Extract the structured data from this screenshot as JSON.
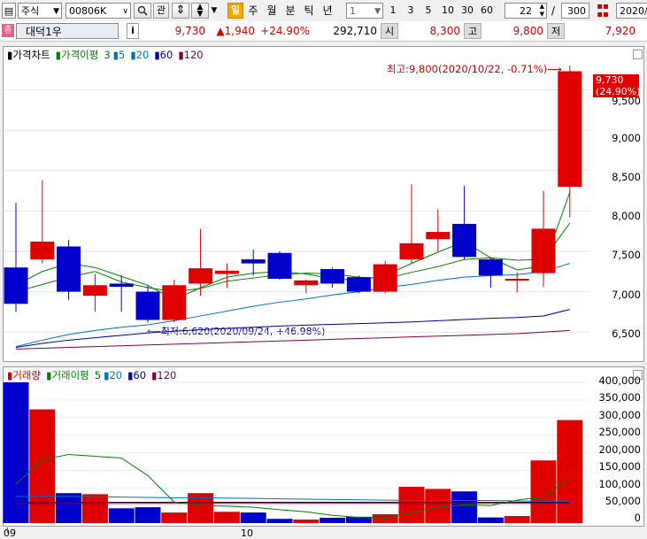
{
  "toolbar": {
    "market_select": "주식",
    "code_input": "00806K",
    "search_icon": "search-icon",
    "gwan_label": "관",
    "period_active": "일",
    "period_labels": [
      "주",
      "월",
      "분",
      "틱",
      "년"
    ],
    "interval_select": "1",
    "interval_buttons": [
      "1",
      "3",
      "5",
      "10",
      "30",
      "60"
    ],
    "count_value": "22",
    "slash": "/",
    "total_value": "300",
    "date_value": "2020/",
    "colors": {
      "active_period": "#f5a800",
      "up": "#e00000",
      "down": "#0000cc"
    }
  },
  "quote": {
    "badge": "종",
    "name": "대덕1우",
    "info_label": "i",
    "price": "9,730",
    "change": "▲1,940",
    "change_pct": "+24.90%",
    "volume": "292,710",
    "open_label": "시",
    "open": "8,300",
    "high_label": "고",
    "high": "9,800",
    "low_label": "저",
    "low": "7,920"
  },
  "price_panel": {
    "legend": {
      "main": "가격차트",
      "ma_name": "가격이평",
      "ma_periods": [
        "3",
        "5",
        "20",
        "60",
        "120"
      ]
    },
    "y_ticks": [
      "9,500",
      "9,000",
      "8,500",
      "8,000",
      "7,500",
      "7,000",
      "6,500"
    ],
    "price_tag": "9,730",
    "pct_tag": "(24.90%)",
    "high_annotation": "최고:9,800(2020/10/22, -0.71%)",
    "low_annotation": "최저:6,620(2020/09/24, +46.98%)"
  },
  "volume_panel": {
    "legend": {
      "main": "거래량",
      "ma_name": "거래이평",
      "ma_periods": [
        "5",
        "20",
        "60",
        "120"
      ]
    },
    "y_ticks": [
      "400,000",
      "350,000",
      "300,000",
      "250,000",
      "200,000",
      "150,000",
      "100,000",
      "50,000",
      "0"
    ]
  },
  "x_axis": {
    "ticks": [
      "09",
      "10"
    ]
  },
  "chart_data": {
    "type": "candlestick",
    "candles": [
      {
        "open": 7300,
        "high": 8100,
        "low": 6750,
        "close": 6850,
        "volume": 400000
      },
      {
        "open": 7400,
        "high": 8380,
        "low": 7350,
        "close": 7620,
        "volume": 323000
      },
      {
        "open": 7560,
        "high": 7640,
        "low": 6900,
        "close": 7000,
        "volume": 85000
      },
      {
        "open": 6950,
        "high": 7220,
        "low": 6750,
        "close": 7080,
        "volume": 82000
      },
      {
        "open": 7100,
        "high": 7200,
        "low": 6750,
        "close": 7060,
        "volume": 42000
      },
      {
        "open": 7000,
        "high": 7080,
        "low": 6620,
        "close": 6650,
        "volume": 45000
      },
      {
        "open": 6650,
        "high": 7150,
        "low": 6620,
        "close": 7080,
        "volume": 30000
      },
      {
        "open": 7100,
        "high": 7780,
        "low": 6950,
        "close": 7290,
        "volume": 85000
      },
      {
        "open": 7220,
        "high": 7350,
        "low": 7050,
        "close": 7260,
        "volume": 32000
      },
      {
        "open": 7400,
        "high": 7520,
        "low": 7200,
        "close": 7350,
        "volume": 30000
      },
      {
        "open": 7480,
        "high": 7500,
        "low": 7150,
        "close": 7160,
        "volume": 12000
      },
      {
        "open": 7080,
        "high": 7150,
        "low": 6980,
        "close": 7140,
        "volume": 10000
      },
      {
        "open": 7280,
        "high": 7300,
        "low": 7050,
        "close": 7100,
        "volume": 15000
      },
      {
        "open": 7180,
        "high": 7200,
        "low": 6980,
        "close": 7000,
        "volume": 18000
      },
      {
        "open": 7000,
        "high": 7380,
        "low": 6980,
        "close": 7340,
        "volume": 25000
      },
      {
        "open": 7400,
        "high": 8330,
        "low": 7350,
        "close": 7600,
        "volume": 103000
      },
      {
        "open": 7650,
        "high": 8020,
        "low": 7500,
        "close": 7740,
        "volume": 97000
      },
      {
        "open": 7840,
        "high": 8310,
        "low": 7400,
        "close": 7430,
        "volume": 90000
      },
      {
        "open": 7400,
        "high": 7420,
        "low": 7050,
        "close": 7200,
        "volume": 16000
      },
      {
        "open": 7140,
        "high": 7240,
        "low": 6990,
        "close": 7160,
        "volume": 20000
      },
      {
        "open": 7230,
        "high": 8250,
        "low": 7060,
        "close": 7780,
        "volume": 178000
      },
      {
        "open": 8300,
        "high": 9800,
        "low": 7920,
        "close": 9730,
        "volume": 292710
      }
    ],
    "price_ylim": [
      6250,
      9900
    ],
    "volume_ylim": [
      0,
      420000
    ],
    "price_ma": {
      "ma3": [
        7080,
        7250,
        7350,
        7300,
        7190,
        7080,
        6900,
        7050,
        7180,
        7230,
        7250,
        7220,
        7160,
        7140,
        7200,
        7350,
        7490,
        7620,
        7420,
        7270,
        7320,
        8230
      ],
      "ma5": [
        7000,
        7090,
        7180,
        7250,
        7120,
        7050,
        7000,
        7040,
        7130,
        7170,
        7210,
        7230,
        7220,
        7180,
        7160,
        7240,
        7310,
        7400,
        7420,
        7390,
        7400,
        7850
      ],
      "ma20": [
        6320,
        6400,
        6470,
        6520,
        6560,
        6590,
        6640,
        6700,
        6760,
        6820,
        6870,
        6910,
        6960,
        7000,
        7050,
        7090,
        7140,
        7180,
        7200,
        7210,
        7250,
        7350
      ],
      "ma60": [
        6310,
        6360,
        6400,
        6430,
        6460,
        6490,
        6510,
        6530,
        6545,
        6560,
        6575,
        6585,
        6595,
        6605,
        6615,
        6625,
        6640,
        6655,
        6670,
        6680,
        6700,
        6780
      ],
      "ma120": [
        6290,
        6300,
        6310,
        6320,
        6330,
        6340,
        6350,
        6360,
        6370,
        6380,
        6390,
        6400,
        6410,
        6420,
        6430,
        6440,
        6450,
        6460,
        6470,
        6480,
        6500,
        6520
      ]
    },
    "volume_ma": {
      "ma5": [
        110000,
        180000,
        195000,
        190000,
        185000,
        135000,
        60000,
        50000,
        48000,
        45000,
        38000,
        32000,
        22000,
        16000,
        15000,
        30000,
        45000,
        52000,
        50000,
        65000,
        75000,
        125000
      ],
      "ma20": [
        75000,
        76000,
        76000,
        75000,
        74000,
        73000,
        72000,
        72000,
        71000,
        70000,
        69000,
        68000,
        67000,
        66000,
        65000,
        64000,
        64000,
        64000,
        64000,
        63000,
        62000,
        62000
      ],
      "ma60": [
        58000,
        58500,
        59000,
        59000,
        59000,
        59000,
        59000,
        59000,
        59000,
        59000,
        59000,
        59000,
        59000,
        59000,
        59000,
        59000,
        59000,
        59000,
        59000,
        59000,
        59000,
        60000
      ],
      "ma120": [
        55000,
        55200,
        55400,
        55600,
        55800,
        56000,
        56000,
        56000,
        56000,
        56000,
        56000,
        56000,
        56000,
        56000,
        56000,
        56000,
        56000,
        56000,
        56000,
        56000,
        56000,
        56000
      ]
    },
    "ma_colors": {
      "ma3": "#008000",
      "ma5": "#008000",
      "ma20": "#0070c0",
      "ma60": "#000099",
      "ma120": "#800040"
    }
  }
}
